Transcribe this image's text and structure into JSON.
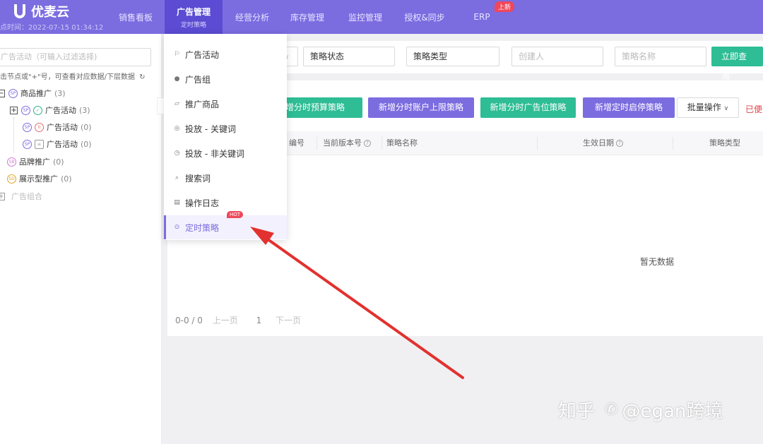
{
  "app": {
    "name": "优麦云",
    "sync_time": "点时间：2022-07-15 01:34:12"
  },
  "nav": {
    "items": [
      {
        "label": "销售看板"
      },
      {
        "label": "广告管理",
        "sub": "定时策略",
        "active": true
      },
      {
        "label": "经营分析"
      },
      {
        "label": "库存管理"
      },
      {
        "label": "监控管理"
      },
      {
        "label": "授权&同步"
      },
      {
        "label": "ERP",
        "badge": "上新"
      }
    ]
  },
  "sidebar": {
    "search_placeholder": "广告活动（可输入过滤选择)",
    "hint": "击节点或\"+\"号，可查看对应数据/下层数据",
    "tree": [
      {
        "label": "商品推广",
        "count": "(3)",
        "icon": "sp"
      },
      {
        "label": "广告活动",
        "count": "(3)",
        "icon": "sp"
      },
      {
        "label": "广告活动",
        "count": "(0)",
        "icon": "sp"
      },
      {
        "label": "广告活动",
        "count": "(0)",
        "icon": "sp"
      },
      {
        "label": "品牌推广",
        "count": "(0)",
        "icon": "sb"
      },
      {
        "label": "展示型推广",
        "count": "(0)",
        "icon": "sd"
      },
      {
        "label": "广告组合",
        "count": ""
      }
    ]
  },
  "filters": {
    "status": "策略状态",
    "type": "策略类型",
    "creator_placeholder": "创建人",
    "name_placeholder": "策略名称",
    "query_button": "立即查询"
  },
  "actions": {
    "add_budget": "新增分时预算策略",
    "add_account_cap": "新增分时账户上限策略",
    "add_placement": "新增分时广告位策略",
    "add_schedule": "新增定时启停策略",
    "batch": "批量操作",
    "done": "已便"
  },
  "table": {
    "headers": [
      "编号",
      "当前版本号",
      "策略名称",
      "生效日期",
      "策略类型"
    ],
    "empty_text": "暂无数据"
  },
  "pager": {
    "range": "0-0 / 0",
    "prev": "上一页",
    "page": "1",
    "next": "下一页"
  },
  "menu": {
    "items": [
      {
        "label": "广告活动",
        "icon": "flag-icon"
      },
      {
        "label": "广告组",
        "icon": "group-icon"
      },
      {
        "label": "推广商品",
        "icon": "product-icon"
      },
      {
        "label": "投放 - 关键词",
        "icon": "keyword-icon"
      },
      {
        "label": "投放 - 非关键词",
        "icon": "target-icon"
      },
      {
        "label": "搜索词",
        "icon": "search-icon"
      },
      {
        "label": "操作日志",
        "icon": "log-icon"
      },
      {
        "label": "定时策略",
        "icon": "timer-icon",
        "badge": "HOT",
        "active": true
      }
    ]
  },
  "watermark": {
    "site": "知乎",
    "author": "@egan跨境"
  },
  "colors": {
    "brand_purple": "#7b6ce0",
    "action_green": "#2ebd95",
    "annotation_red": "#e2312e"
  }
}
